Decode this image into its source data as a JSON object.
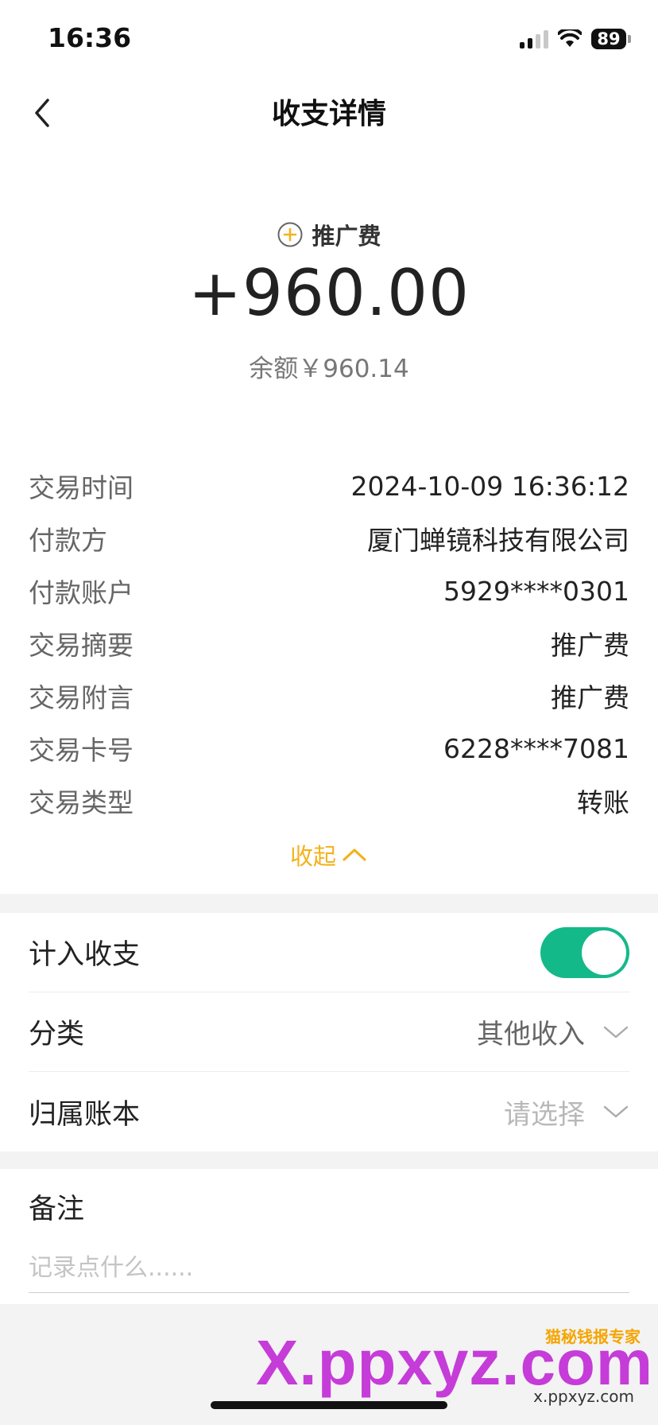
{
  "status_bar": {
    "time": "16:36",
    "battery": "89"
  },
  "nav": {
    "title": "收支详情",
    "back_icon": "chevron-left-icon"
  },
  "summary": {
    "category": "推广费",
    "category_icon": "plus-circle-icon",
    "amount": "+960.00",
    "balance": "余额￥960.14"
  },
  "details": [
    {
      "label": "交易时间",
      "value": "2024-10-09 16:36:12"
    },
    {
      "label": "付款方",
      "value": "厦门蝉镜科技有限公司"
    },
    {
      "label": "付款账户",
      "value": "5929****0301"
    },
    {
      "label": "交易摘要",
      "value": "推广费"
    },
    {
      "label": "交易附言",
      "value": "推广费"
    },
    {
      "label": "交易卡号",
      "value": "6228****7081"
    },
    {
      "label": "交易类型",
      "value": "转账"
    }
  ],
  "collapse_label": "收起",
  "settings": {
    "include_label": "计入收支",
    "include_enabled": true,
    "category_label": "分类",
    "category_value": "其他收入",
    "ledger_label": "归属账本",
    "ledger_placeholder": "请选择"
  },
  "note": {
    "title": "备注",
    "placeholder": "记录点什么......"
  },
  "watermark": {
    "main": "X.ppxyz.com",
    "badge": "猫秘钱报专家",
    "sub": "x.ppxyz.com"
  },
  "colors": {
    "accent": "#f3b21c",
    "toggle": "#14b98a"
  }
}
